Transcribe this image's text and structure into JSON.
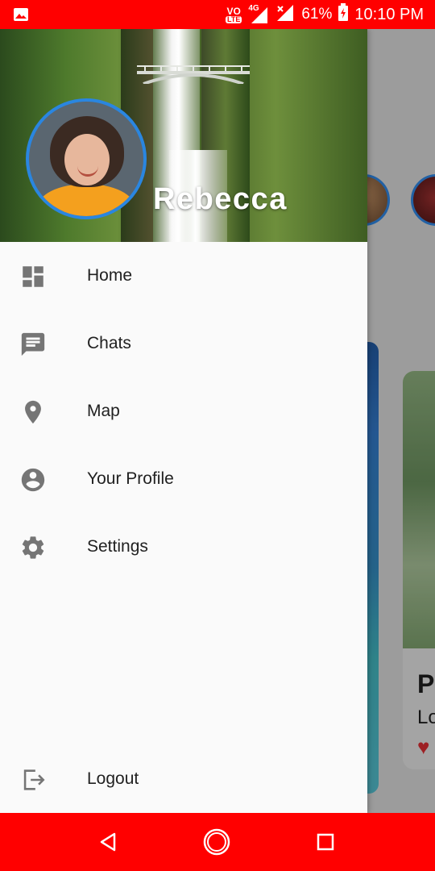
{
  "status_bar": {
    "battery": "61%",
    "time": "10:10 PM",
    "network": "4G",
    "volte": "VO",
    "lte": "LTE",
    "bg_color": "#ff0000"
  },
  "drawer": {
    "header": {
      "user_name": "Rebecca"
    },
    "menu": [
      {
        "label": "Home",
        "icon": "dashboard-icon"
      },
      {
        "label": "Chats",
        "icon": "chat-icon"
      },
      {
        "label": "Map",
        "icon": "location-pin-icon"
      },
      {
        "label": "Your Profile",
        "icon": "account-circle-icon"
      },
      {
        "label": "Settings",
        "icon": "gear-icon"
      }
    ],
    "logout_label": "Logout"
  },
  "background_app": {
    "card_title_partial": "P",
    "card_subtitle_partial": "Lo"
  },
  "nav_bar": {
    "bg_color": "#ff0000",
    "buttons": [
      "back-icon",
      "home-icon",
      "recents-icon"
    ]
  }
}
